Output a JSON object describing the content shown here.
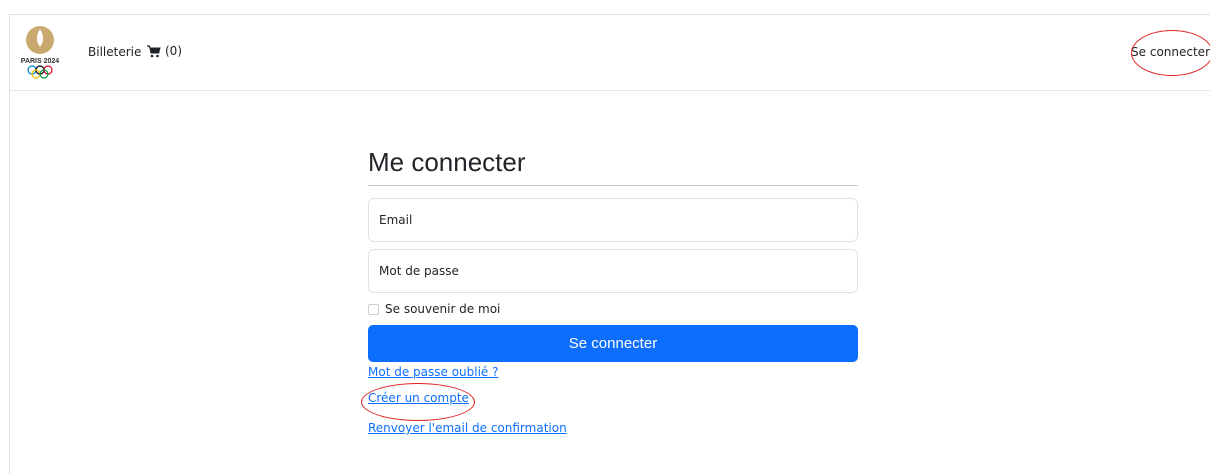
{
  "navbar": {
    "logo_text": "PARIS 2024",
    "ticketing_label": "Billeterie",
    "cart_count": "(0)",
    "login_link": "Se connecter"
  },
  "login": {
    "title": "Me connecter",
    "email_placeholder": "Email",
    "password_placeholder": "Mot de passe",
    "remember_label": "Se souvenir de moi",
    "submit_label": "Se connecter",
    "forgot_password_link": "Mot de passe oublié ?",
    "create_account_link": "Créer un compte",
    "resend_email_link": "Renvoyer l'email de confirmation"
  },
  "colors": {
    "primary": "#0d6efd",
    "logo_gold": "#c9a96e",
    "annotation_red": "#e02020"
  }
}
